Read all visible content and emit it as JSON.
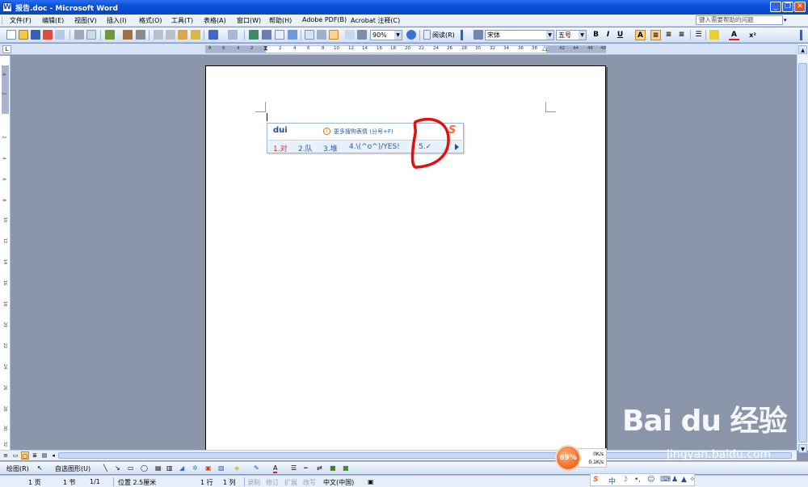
{
  "window": {
    "title": "报告.doc - Microsoft Word",
    "minimize": "_",
    "restore": "❐",
    "close": "✕"
  },
  "menubar": {
    "items": [
      "文件(F)",
      "编辑(E)",
      "视图(V)",
      "插入(I)",
      "格式(O)",
      "工具(T)",
      "表格(A)",
      "窗口(W)",
      "帮助(H)",
      "Adobe PDF(B)",
      "Acrobat 注释(C)"
    ],
    "help_placeholder": "键入需要帮助的问题"
  },
  "toolbar": {
    "zoom": "90%",
    "read_label": "阅读(R)",
    "font": "宋体",
    "font_size": "五号",
    "bold": "B",
    "italic": "I",
    "underline": "U",
    "char_border": "A"
  },
  "ruler": {
    "ticks": [
      "8",
      "6",
      "4",
      "2",
      "",
      "2",
      "4",
      "6",
      "8",
      "10",
      "12",
      "14",
      "16",
      "18",
      "20",
      "22",
      "24",
      "26",
      "28",
      "30",
      "32",
      "34",
      "36",
      "38",
      "",
      "42",
      "44",
      "46",
      "48"
    ],
    "vticks": [
      "4",
      "2",
      "",
      "2",
      "4",
      "6",
      "8",
      "10",
      "12",
      "14",
      "16",
      "18",
      "20",
      "22",
      "24",
      "26",
      "28",
      "30",
      "32"
    ]
  },
  "ime": {
    "input": "dui",
    "hint": "更多搜狗表情 (分号+F)",
    "candidates": [
      "1.对",
      "2.队",
      "3.堆",
      "4.\\(^o^)/YES!",
      "5.✓"
    ]
  },
  "drawbar": {
    "draw": "绘图(R)",
    "autoshape": "自选图形(U)"
  },
  "status": {
    "page": "1 页",
    "section": "1 节",
    "pages": "1/1",
    "position": "位置 2.5厘米",
    "line": "1 行",
    "col": "1 列",
    "rec": "录制",
    "trk": "修订",
    "ext": "扩展",
    "ovr": "改写",
    "lang": "中文(中国)"
  },
  "speed_widget": {
    "percent": "69%",
    "up": "0K/s",
    "down": "0.1K/s"
  },
  "imebar": {
    "mode": "中"
  },
  "watermark": {
    "logo": "Bai du 经验",
    "url": "jingyan.baidu.com"
  }
}
